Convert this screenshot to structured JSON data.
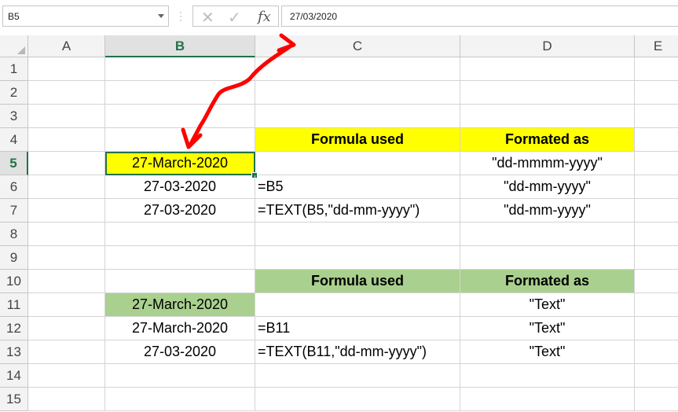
{
  "formula_bar": {
    "name_box": "B5",
    "formula": "27/03/2020",
    "cancel_icon": "✕",
    "confirm_icon": "✓",
    "fx_label": "fx"
  },
  "columns": [
    "A",
    "B",
    "C",
    "D",
    "E"
  ],
  "rows": [
    "1",
    "2",
    "3",
    "4",
    "5",
    "6",
    "7",
    "8",
    "9",
    "10",
    "11",
    "12",
    "13",
    "14",
    "15"
  ],
  "cells": {
    "C4": "Formula used",
    "D4": "Formated as",
    "B5": "27-March-2020",
    "D5": "\"dd-mmmm-yyyy\"",
    "B6": "27-03-2020",
    "C6": "=B5",
    "D6": "\"dd-mm-yyyy\"",
    "B7": "27-03-2020",
    "C7": "=TEXT(B5,\"dd-mm-yyyy\")",
    "D7": "\"dd-mm-yyyy\"",
    "C10": "Formula used",
    "D10": "Formated as",
    "B11": "27-March-2020",
    "D11": "\"Text\"",
    "B12": "27-March-2020",
    "C12": "=B11",
    "D12": "\"Text\"",
    "B13": "27-03-2020",
    "C13": "=TEXT(B11,\"dd-mm-yyyy\")",
    "D13": "\"Text\""
  },
  "colors": {
    "yellow_fill": "#ffff00",
    "green_fill": "#a9d08e",
    "selection": "#217346",
    "arrow": "#ff0000"
  }
}
